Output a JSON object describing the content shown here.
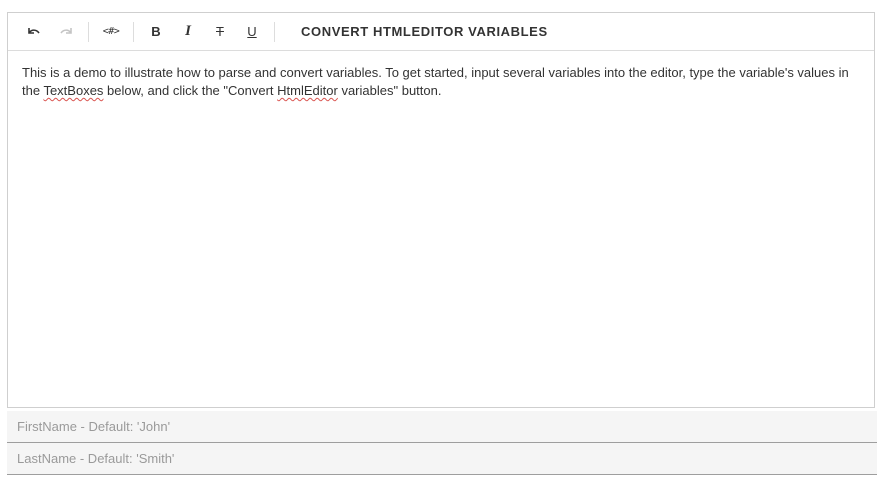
{
  "toolbar": {
    "undo_icon": "undo-icon",
    "redo_icon": "redo-icon",
    "html_code_glyph": "<#>",
    "bold_glyph": "B",
    "italic_glyph": "I",
    "strike_glyph": "T",
    "underline_glyph": "U",
    "convert_label": "CONVERT HTMLEDITOR VARIABLES"
  },
  "content": {
    "part1": "This is a demo to illustrate how to parse and convert variables. To get started, input several variables into the editor, type the variable's values in the ",
    "word1": "TextBoxes",
    "part2": " below, and click the \"Convert ",
    "word2": "HtmlEditor",
    "part3": " variables\" button."
  },
  "fields": {
    "first_name": {
      "value": "",
      "placeholder": "FirstName - Default: 'John'"
    },
    "last_name": {
      "value": "",
      "placeholder": "LastName - Default: 'Smith'"
    }
  }
}
